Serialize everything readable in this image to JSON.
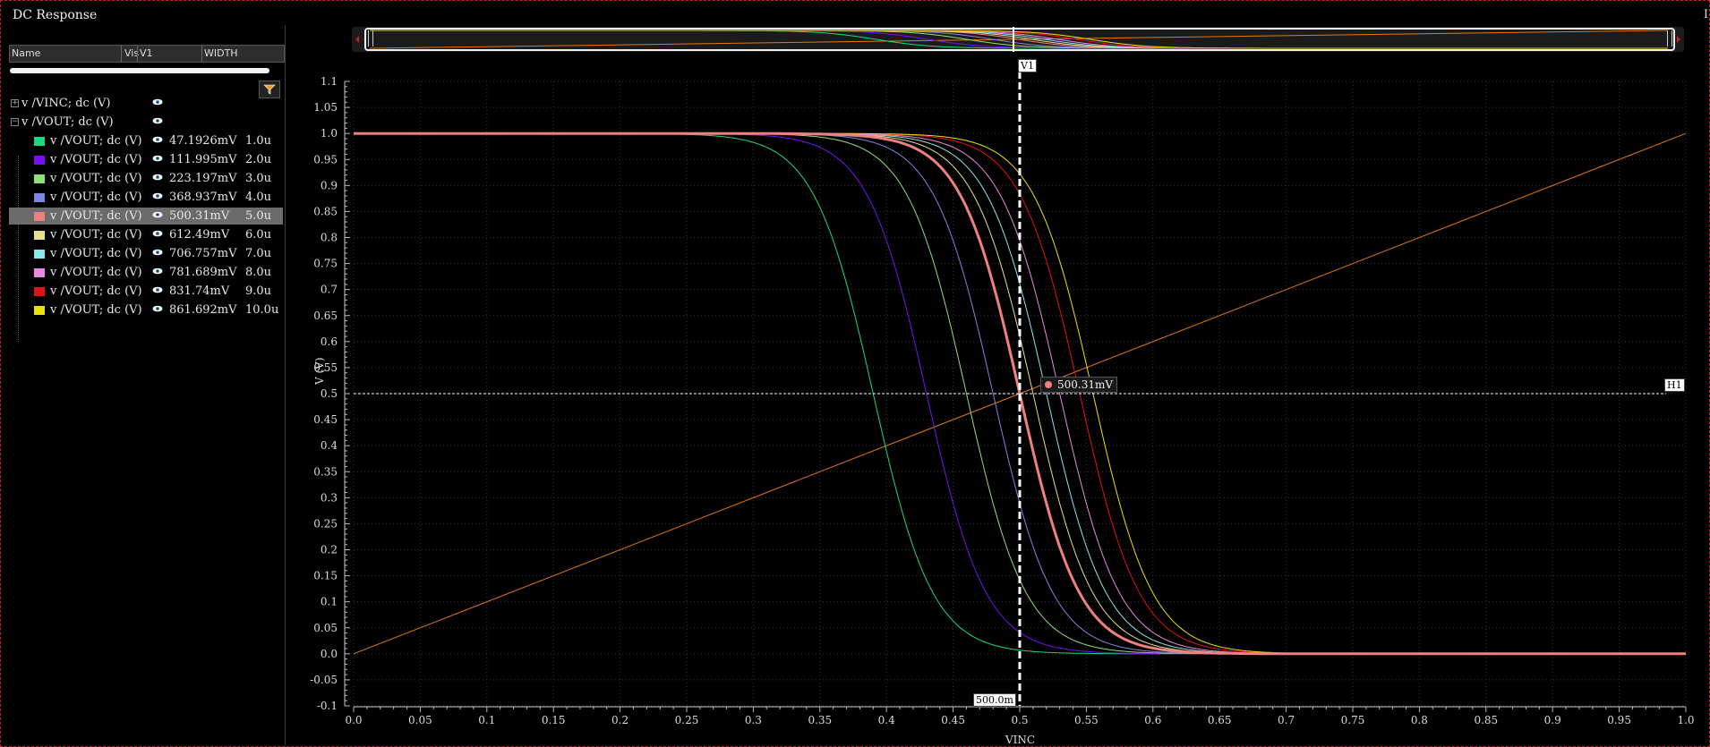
{
  "window": {
    "title": "DC Response",
    "corner": "I"
  },
  "sidebar": {
    "headers": {
      "name": "Name",
      "vis": "Vis",
      "v1": "V1",
      "width": "WIDTH"
    },
    "rows": [
      {
        "name": "v /VINC; dc (V)",
        "value": "",
        "width": "",
        "color": "",
        "toggle": "+",
        "level": 0
      },
      {
        "name": "v /VOUT; dc (V)",
        "value": "",
        "width": "",
        "color": "",
        "toggle": "−",
        "level": 0
      },
      {
        "name": "v /VOUT; dc (V)",
        "value": "47.1926mV",
        "width": "1.0u",
        "color": "#19d97f",
        "level": 1
      },
      {
        "name": "v /VOUT; dc (V)",
        "value": "111.995mV",
        "width": "2.0u",
        "color": "#7a0ef0",
        "level": 1
      },
      {
        "name": "v /VOUT; dc (V)",
        "value": "223.197mV",
        "width": "3.0u",
        "color": "#8fe07a",
        "level": 1
      },
      {
        "name": "v /VOUT; dc (V)",
        "value": "368.937mV",
        "width": "4.0u",
        "color": "#7d86e0",
        "level": 1
      },
      {
        "name": "v /VOUT; dc (V)",
        "value": "500.31mV",
        "width": "5.0u",
        "color": "#f08080",
        "level": 1,
        "selected": true
      },
      {
        "name": "v /VOUT; dc (V)",
        "value": "612.49mV",
        "width": "6.0u",
        "color": "#e6e08a",
        "level": 1
      },
      {
        "name": "v /VOUT; dc (V)",
        "value": "706.757mV",
        "width": "7.0u",
        "color": "#8ae6ea",
        "level": 1
      },
      {
        "name": "v /VOUT; dc (V)",
        "value": "781.689mV",
        "width": "8.0u",
        "color": "#e88ae0",
        "level": 1
      },
      {
        "name": "v /VOUT; dc (V)",
        "value": "831.74mV",
        "width": "9.0u",
        "color": "#e31212",
        "level": 1
      },
      {
        "name": "v /VOUT; dc (V)",
        "value": "861.692mV",
        "width": "10.0u",
        "color": "#e8e012",
        "level": 1
      }
    ]
  },
  "plot": {
    "vmarker_label": "V1",
    "hmarker_label": "H1",
    "x_readout": "500.0m",
    "point_readout": "500.31mV",
    "xlabel": "VINC",
    "ylabel": "V (V)"
  },
  "chart_data": {
    "type": "line",
    "xlabel": "VINC",
    "ylabel": "V (V)",
    "xlim": [
      0.0,
      1.0
    ],
    "ylim": [
      -0.1,
      1.1
    ],
    "x_ticks": [
      "0.0",
      "0.05",
      "0.1",
      "0.15",
      "0.2",
      "0.25",
      "0.3",
      "0.35",
      "0.4",
      "0.45",
      "0.5",
      "0.55",
      "0.6",
      "0.65",
      "0.7",
      "0.75",
      "0.8",
      "0.85",
      "0.9",
      "0.95",
      "1.0"
    ],
    "y_ticks": [
      "1.1",
      "1.05",
      "1.0",
      "0.95",
      "0.9",
      "0.85",
      "0.8",
      "0.75",
      "0.7",
      "0.65",
      "0.6",
      "0.55",
      "0.5",
      "0.45",
      "0.4",
      "0.35",
      "0.3",
      "0.25",
      "0.2",
      "0.15",
      "0.1",
      "0.05",
      "0.0",
      "-0.05",
      "-0.1"
    ],
    "vinc_series": {
      "color": "#e07a10",
      "x": [
        0.0,
        1.0
      ],
      "y": [
        0.0,
        1.0
      ]
    },
    "vout_series": [
      {
        "width": "1.0u",
        "color": "#19d97f",
        "vm": 0.39,
        "k": 45
      },
      {
        "width": "2.0u",
        "color": "#7a0ef0",
        "vm": 0.43,
        "k": 45
      },
      {
        "width": "3.0u",
        "color": "#8fe07a",
        "vm": 0.46,
        "k": 45
      },
      {
        "width": "4.0u",
        "color": "#7d86e0",
        "vm": 0.48,
        "k": 45
      },
      {
        "width": "5.0u",
        "color": "#f08080",
        "vm": 0.5,
        "k": 45,
        "highlight": true
      },
      {
        "width": "6.0u",
        "color": "#e6e08a",
        "vm": 0.51,
        "k": 45
      },
      {
        "width": "7.0u",
        "color": "#8ae6ea",
        "vm": 0.52,
        "k": 45
      },
      {
        "width": "8.0u",
        "color": "#e88ae0",
        "vm": 0.53,
        "k": 45
      },
      {
        "width": "9.0u",
        "color": "#e31212",
        "vm": 0.545,
        "k": 45
      },
      {
        "width": "10.0u",
        "color": "#e8e012",
        "vm": 0.555,
        "k": 45
      }
    ],
    "vertical_marker": {
      "label": "V1",
      "x": 0.5
    },
    "horizontal_marker": {
      "label": "H1",
      "y": 0.5
    },
    "grid": true
  }
}
